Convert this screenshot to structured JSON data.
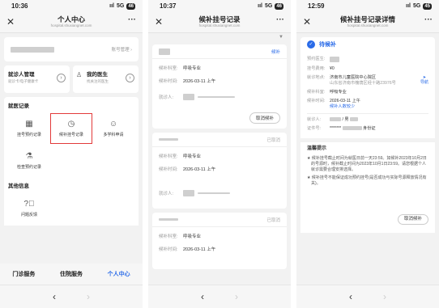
{
  "phones": {
    "p1": {
      "status": {
        "time": "10:36",
        "signal": "5G",
        "battery": "46"
      },
      "nav": {
        "title": "个人中心",
        "subtitle": "hospital.shuxiangnet.com"
      },
      "account_link": "账号管理",
      "cards": [
        {
          "title": "就诊人管理",
          "sub": "就诊卡/电子健康卡"
        },
        {
          "title": "我的医生",
          "sub": "找关注的医生"
        }
      ],
      "records_header": "就医记录",
      "records": [
        "挂号预约记录",
        "候补挂号记录",
        "多学科申请",
        "检查预约记录"
      ],
      "other_header": "其他信息",
      "other": [
        "问题反馈"
      ],
      "tabs": [
        "门诊服务",
        "住院服务",
        "个人中心"
      ],
      "bottom_nav": {
        "back": "‹",
        "forward": "›"
      }
    },
    "p2": {
      "status": {
        "time": "10:37",
        "signal": "5G",
        "battery": "46"
      },
      "nav": {
        "title": "候补挂号记录",
        "subtitle": "hospital.shuxiangnet.com"
      },
      "records": [
        {
          "status": "候补",
          "dept_label": "候补科室:",
          "dept": "呼吸专业",
          "time_label": "候补时间:",
          "time": "2026-03-11 上午",
          "patient_label": "就诊人:",
          "cancel": "取消候补"
        },
        {
          "status": "已取消",
          "dept_label": "候补科室:",
          "dept": "呼吸专业",
          "time_label": "候补时间:",
          "time": "2026-03-11 上午",
          "patient_label": "就诊人:"
        },
        {
          "status": "已取消",
          "dept_label": "候补科室:",
          "dept": "呼吸专业",
          "time_label": "候补时间:",
          "time": "2026-03-11 上午"
        }
      ],
      "bottom_nav": {
        "back": "‹",
        "forward": "›"
      }
    },
    "p3": {
      "status": {
        "time": "12:59",
        "signal": "5G",
        "battery": "45"
      },
      "nav": {
        "title": "候补挂号记录详情",
        "subtitle": "hospital.shuxiangnet.com"
      },
      "state": "待候补",
      "details": {
        "doctor_label": "预约医生:",
        "fee_label": "挂号费用:",
        "fee": "¥0",
        "place_label": "就诊地点:",
        "place": "济南市儿童医院中心院区",
        "address": "山东省济南市槐荫区经十路23976号",
        "nav_label": "导航",
        "dept_label": "候补科室:",
        "dept": "呼吸专业",
        "time_label": "候补时间:",
        "time": "2026-03-11 上午",
        "people": "候补人数较少",
        "patient_label": "就诊人:",
        "patient_sex": "/ 男",
        "id_label": "证件号:",
        "id_masked": "*******",
        "id_type": "身份证"
      },
      "tips": {
        "title": "温馨提示",
        "items": [
          "候补挂号截止时间为就医日前一天23:59。如候补2023年10月2日的号源时，候补截止时间为2023年10月1日23:59。请您根据个人就诊需要合理安排选择。",
          "候补挂号不能保证成功预约挂号(是否成功与实际号源释放情况有关)。"
        ],
        "cancel": "取消候补"
      },
      "bottom_nav": {
        "back": "‹",
        "forward": "›"
      }
    }
  }
}
